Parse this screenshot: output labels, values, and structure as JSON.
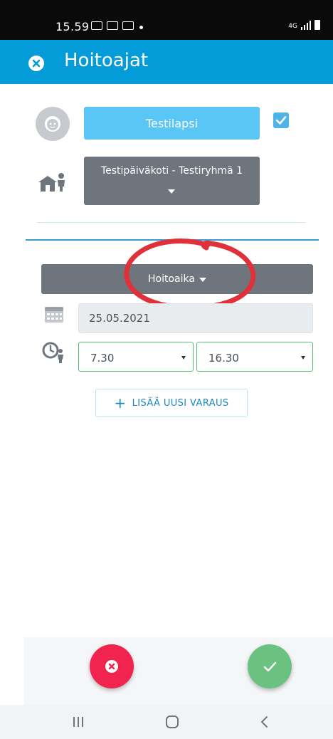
{
  "status_bar": {
    "time": "15.59",
    "network": "4G"
  },
  "app_bar": {
    "title": "Hoitoajat"
  },
  "child": {
    "name": "Testilapsi",
    "selected": true
  },
  "group": {
    "selected": "Testipäiväkoti - Testiryhmä 1"
  },
  "reservation": {
    "type_label": "Hoitoaika",
    "date": "25.05.2021",
    "start_time": "7.30",
    "end_time": "16.30"
  },
  "actions": {
    "add_label": "LISÄÄ UUSI VARAUS"
  },
  "colors": {
    "app_bar": "#049bd9",
    "child_button": "#59c6f6",
    "select_gray": "#6f757d",
    "cancel": "#f0244e",
    "confirm": "#6bc280",
    "annotation": "#e0313a"
  },
  "icons": {
    "app_close": "close-circle-icon",
    "avatar": "child-face-icon",
    "daycare": "daycare-house-person-icon",
    "calendar": "calendar-icon",
    "clock": "clock-person-icon",
    "add": "plus-icon",
    "cancel": "close-icon",
    "confirm": "check-icon"
  }
}
